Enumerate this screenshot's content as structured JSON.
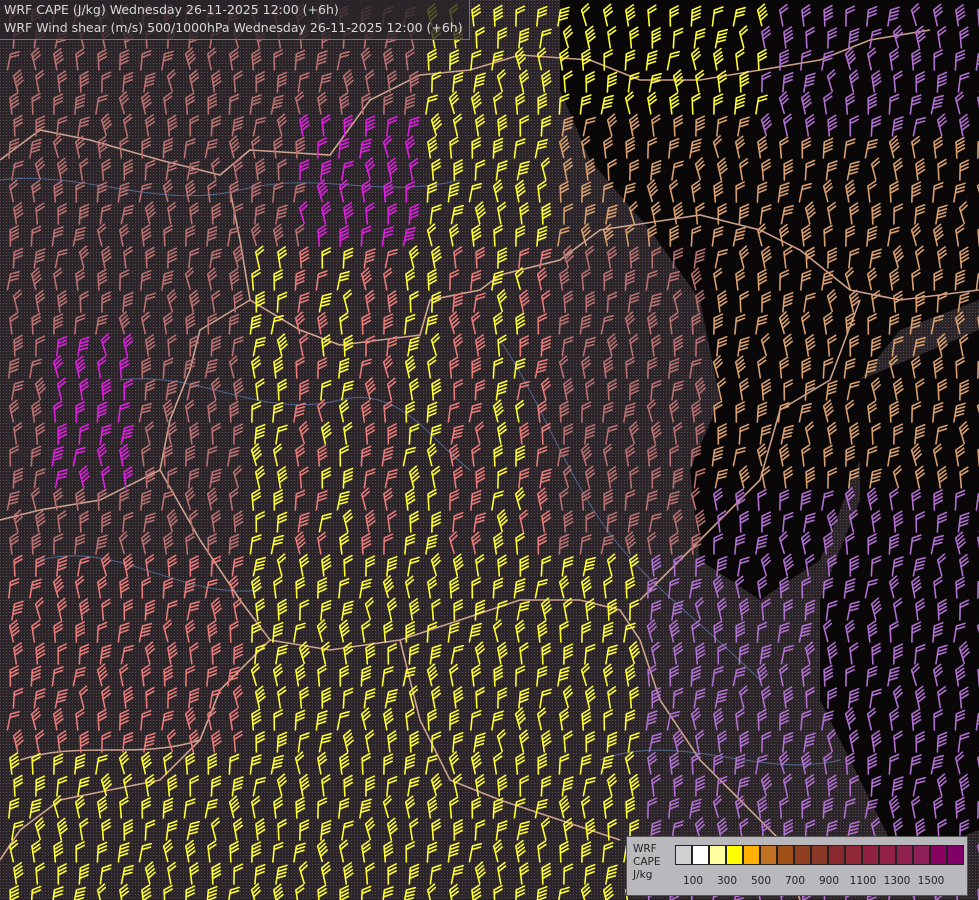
{
  "title": {
    "line1": "WRF CAPE (J/kg) Wednesday 26-11-2025 12:00 (+6h)",
    "line2": "WRF Wind shear (m/s) 500/1000hPa Wednesday 26-11-2025 12:00 (+6h)"
  },
  "legend": {
    "label_line1": "WRF",
    "label_line2": "CAPE",
    "label_line3": "J/kg",
    "colors": [
      "#d0d0d0",
      "#ffffff",
      "#ffffa0",
      "#ffff00",
      "#ffb000",
      "#c07020",
      "#a05018",
      "#904020",
      "#8a3828",
      "#8a2830",
      "#902838",
      "#902040",
      "#902048",
      "#902050",
      "#902058",
      "#880060",
      "#800068"
    ],
    "ticks": [
      "100",
      "300",
      "500",
      "700",
      "900",
      "1100",
      "1300",
      "1500"
    ]
  },
  "colors": {
    "background": "#2d2529",
    "borders": "#d8a890",
    "rivers": "#6b88b8",
    "barb_yellow": "#ffff33",
    "barb_salmon": "#e87a78",
    "barb_magenta": "#e020e0",
    "barb_purple": "#b070d0",
    "barb_tan": "#d8a070",
    "barb_brown": "#b87070",
    "dark_region": "#000000"
  }
}
